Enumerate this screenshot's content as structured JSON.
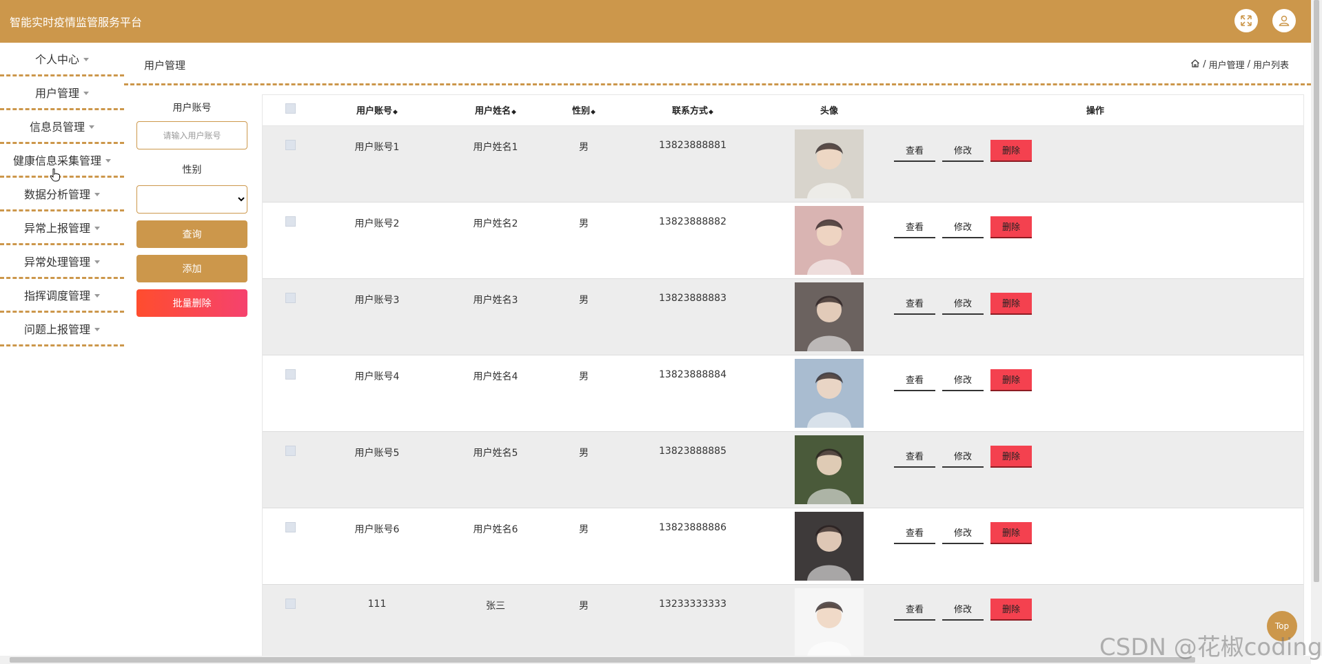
{
  "header": {
    "title": "智能实时疫情监管服务平台"
  },
  "sidebar": {
    "items": [
      {
        "label": "个人中心"
      },
      {
        "label": "用户管理"
      },
      {
        "label": "信息员管理"
      },
      {
        "label": "健康信息采集管理"
      },
      {
        "label": "数据分析管理"
      },
      {
        "label": "异常上报管理"
      },
      {
        "label": "异常处理管理"
      },
      {
        "label": "指挥调度管理"
      },
      {
        "label": "问题上报管理"
      }
    ]
  },
  "page": {
    "title": "用户管理"
  },
  "breadcrumb": {
    "items": [
      "用户管理",
      "用户列表"
    ],
    "sep": "/"
  },
  "filter": {
    "account_label": "用户账号",
    "account_placeholder": "请输入用户账号",
    "gender_label": "性别",
    "gender_value": "",
    "query_label": "查询",
    "add_label": "添加",
    "batch_delete_label": "批量删除"
  },
  "table": {
    "headers": {
      "account": "用户账号",
      "name": "用户姓名",
      "gender": "性别",
      "phone": "联系方式",
      "avatar": "头像",
      "ops": "操作"
    },
    "sort_glyph": "◆",
    "rows": [
      {
        "account": "用户账号1",
        "name": "用户姓名1",
        "gender": "男",
        "phone": "13823888881",
        "avatar_color": "#d8d4cc"
      },
      {
        "account": "用户账号2",
        "name": "用户姓名2",
        "gender": "男",
        "phone": "13823888882",
        "avatar_color": "#d9b4b2"
      },
      {
        "account": "用户账号3",
        "name": "用户姓名3",
        "gender": "男",
        "phone": "13823888883",
        "avatar_color": "#6b625f"
      },
      {
        "account": "用户账号4",
        "name": "用户姓名4",
        "gender": "男",
        "phone": "13823888884",
        "avatar_color": "#a9bcd0"
      },
      {
        "account": "用户账号5",
        "name": "用户姓名5",
        "gender": "男",
        "phone": "13823888885",
        "avatar_color": "#4a5a3a"
      },
      {
        "account": "用户账号6",
        "name": "用户姓名6",
        "gender": "男",
        "phone": "13823888886",
        "avatar_color": "#3e3a3a"
      },
      {
        "account": "111",
        "name": "张三",
        "gender": "男",
        "phone": "13233333333",
        "avatar_color": "#f6f6f6"
      }
    ],
    "ops": {
      "view": "查看",
      "edit": "修改",
      "delete": "删除"
    }
  },
  "top_button": {
    "label": "Top"
  },
  "watermark": {
    "text": "CSDN @花椒coding"
  },
  "colors": {
    "accent": "#cc974b",
    "danger": "#f4414f"
  }
}
